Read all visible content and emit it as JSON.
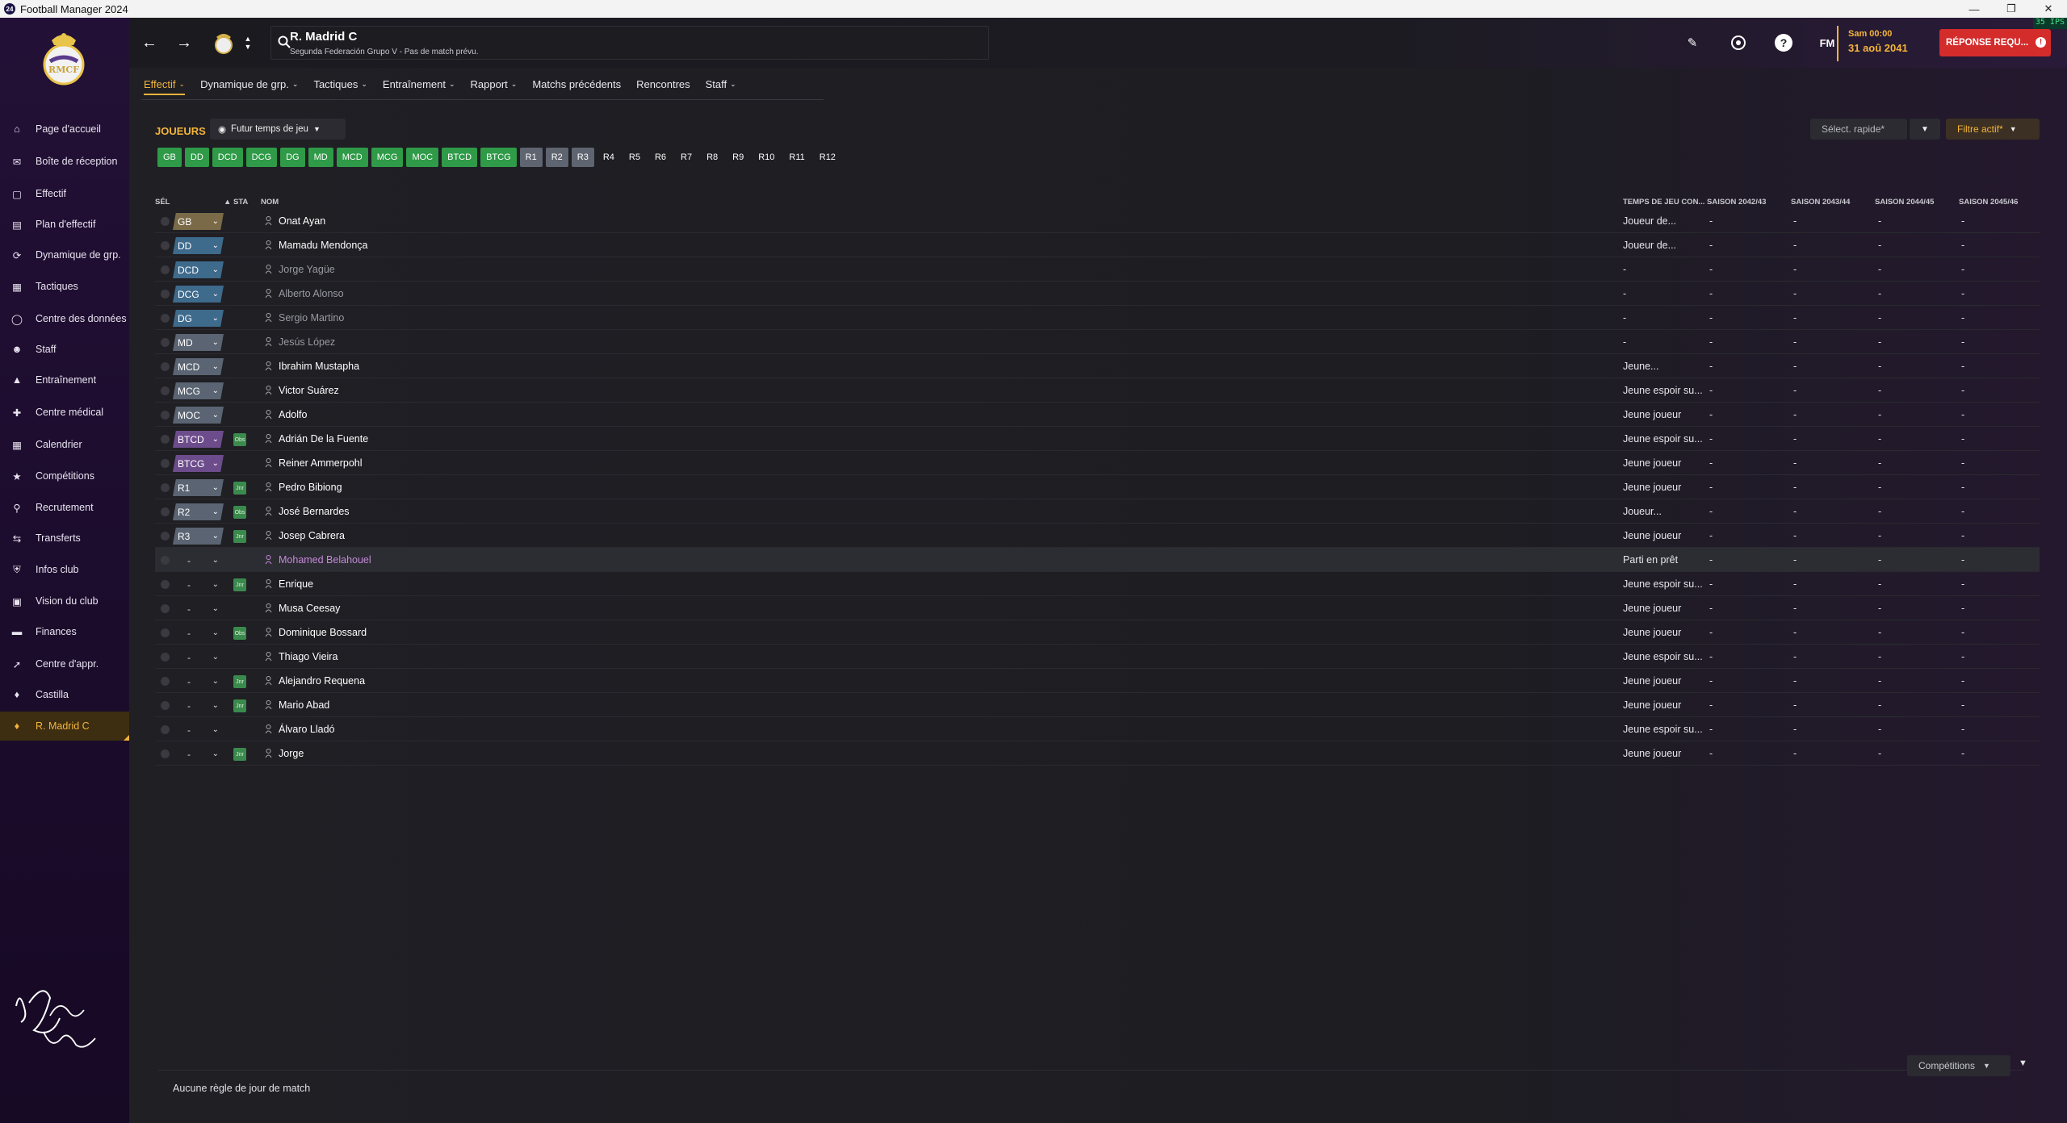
{
  "window": {
    "title": "Football Manager 2024",
    "app_icon": "24",
    "fps": "35 IPS"
  },
  "sidebar": {
    "items": [
      {
        "label": "Page d'accueil",
        "icon": "home-icon"
      },
      {
        "label": "Boîte de réception",
        "icon": "inbox-icon"
      },
      {
        "label": "Effectif",
        "icon": "shirt-icon"
      },
      {
        "label": "Plan d'effectif",
        "icon": "plan-icon"
      },
      {
        "label": "Dynamique de grp.",
        "icon": "dynamics-icon"
      },
      {
        "label": "Tactiques",
        "icon": "tactics-icon"
      },
      {
        "label": "Centre des données",
        "icon": "data-icon"
      },
      {
        "label": "Staff",
        "icon": "staff-icon"
      },
      {
        "label": "Entraînement",
        "icon": "training-icon"
      },
      {
        "label": "Centre médical",
        "icon": "medical-icon"
      },
      {
        "label": "Calendrier",
        "icon": "calendar-icon"
      },
      {
        "label": "Compétitions",
        "icon": "trophy-icon"
      },
      {
        "label": "Recrutement",
        "icon": "scouting-icon"
      },
      {
        "label": "Transferts",
        "icon": "transfers-icon"
      },
      {
        "label": "Infos club",
        "icon": "shield-icon"
      },
      {
        "label": "Vision du club",
        "icon": "vision-icon"
      },
      {
        "label": "Finances",
        "icon": "finances-icon"
      },
      {
        "label": "Centre d'appr.",
        "icon": "academy-icon"
      },
      {
        "label": "Castilla",
        "icon": "team-icon"
      },
      {
        "label": "R. Madrid C",
        "icon": "team-icon",
        "active": true
      }
    ]
  },
  "header": {
    "team_name": "R. Madrid C",
    "team_subtitle": "Segunda Federación Grupo V - Pas de match prévu.",
    "day": "Sam 00:00",
    "date": "31 aoû 2041",
    "reply_label": "RÉPONSE REQU...",
    "fm_label": "FM"
  },
  "subnav": {
    "tabs": [
      "Effectif",
      "Dynamique de grp.",
      "Tactiques",
      "Entraînement",
      "Rapport",
      "Matchs précédents",
      "Rencontres",
      "Staff"
    ]
  },
  "panel": {
    "title": "JOUEURS",
    "view": "Futur temps de jeu",
    "quick_select_placeholder": "Sélect. rapide*",
    "filter": "Filtre actif*",
    "positions_filled": [
      "GB",
      "DD",
      "DCD",
      "DCG",
      "DG",
      "MD",
      "MCD",
      "MCG",
      "MOC",
      "BTCD",
      "BTCG"
    ],
    "positions_reserve_filled": [
      "R1",
      "R2",
      "R3"
    ],
    "positions_reserve_empty": [
      "R4",
      "R5",
      "R6",
      "R7",
      "R8",
      "R9",
      "R10",
      "R11",
      "R12"
    ]
  },
  "table": {
    "headers": {
      "sel": "SÉL",
      "sta": "STA",
      "name": "NOM",
      "playtime": "TEMPS DE JEU CON...",
      "s1": "SAISON 2042/43",
      "s2": "SAISON 2043/44",
      "s3": "SAISON 2044/45",
      "s4": "SAISON 2045/46"
    },
    "rows": [
      {
        "pos": "GB",
        "sta": "",
        "name": "Onat Ayan",
        "playtime": "Joueur de...",
        "s1": "-",
        "s2": "-",
        "s3": "-",
        "s4": "-"
      },
      {
        "pos": "DD",
        "sta": "",
        "name": "Mamadu Mendonça",
        "playtime": "Joueur de...",
        "s1": "-",
        "s2": "-",
        "s3": "-",
        "s4": "-"
      },
      {
        "pos": "DCD",
        "sta": "",
        "name": "Jorge Yagüe",
        "playtime": "-",
        "s1": "-",
        "s2": "-",
        "s3": "-",
        "s4": "-",
        "dim": true
      },
      {
        "pos": "DCG",
        "sta": "",
        "name": "Alberto Alonso",
        "playtime": "-",
        "s1": "-",
        "s2": "-",
        "s3": "-",
        "s4": "-",
        "dim": true
      },
      {
        "pos": "DG",
        "sta": "",
        "name": "Sergio Martino",
        "playtime": "-",
        "s1": "-",
        "s2": "-",
        "s3": "-",
        "s4": "-",
        "dim": true
      },
      {
        "pos": "MD",
        "sta": "",
        "name": "Jesús López",
        "playtime": "-",
        "s1": "-",
        "s2": "-",
        "s3": "-",
        "s4": "-",
        "dim": true
      },
      {
        "pos": "MCD",
        "sta": "",
        "name": "Ibrahim Mustapha",
        "playtime": "Jeune...",
        "s1": "-",
        "s2": "-",
        "s3": "-",
        "s4": "-"
      },
      {
        "pos": "MCG",
        "sta": "",
        "name": "Victor Suárez",
        "playtime": "Jeune espoir su...",
        "s1": "-",
        "s2": "-",
        "s3": "-",
        "s4": "-"
      },
      {
        "pos": "MOC",
        "sta": "",
        "name": "Adolfo",
        "playtime": "Jeune joueur",
        "s1": "-",
        "s2": "-",
        "s3": "-",
        "s4": "-"
      },
      {
        "pos": "BTCD",
        "sta": "Obs",
        "name": "Adrián De la Fuente",
        "playtime": "Jeune espoir su...",
        "s1": "-",
        "s2": "-",
        "s3": "-",
        "s4": "-"
      },
      {
        "pos": "BTCG",
        "sta": "",
        "name": "Reiner Ammerpohl",
        "playtime": "Jeune joueur",
        "s1": "-",
        "s2": "-",
        "s3": "-",
        "s4": "-"
      },
      {
        "pos": "R1",
        "sta": "Jnr",
        "name": "Pedro Bibiong",
        "playtime": "Jeune joueur",
        "s1": "-",
        "s2": "-",
        "s3": "-",
        "s4": "-"
      },
      {
        "pos": "R2",
        "sta": "Obs",
        "name": "José Bernardes",
        "playtime": "Joueur...",
        "s1": "-",
        "s2": "-",
        "s3": "-",
        "s4": "-"
      },
      {
        "pos": "R3",
        "sta": "Jnr",
        "name": "Josep Cabrera",
        "playtime": "Jeune joueur",
        "s1": "-",
        "s2": "-",
        "s3": "-",
        "s4": "-"
      },
      {
        "pos": "-",
        "sta": "",
        "name": "Mohamed Belahouel",
        "playtime": "Parti en prêt",
        "s1": "-",
        "s2": "-",
        "s3": "-",
        "s4": "-",
        "loan": true
      },
      {
        "pos": "-",
        "sta": "Jnr",
        "name": "Enrique",
        "playtime": "Jeune espoir su...",
        "s1": "-",
        "s2": "-",
        "s3": "-",
        "s4": "-"
      },
      {
        "pos": "-",
        "sta": "",
        "name": "Musa Ceesay",
        "playtime": "Jeune joueur",
        "s1": "-",
        "s2": "-",
        "s3": "-",
        "s4": "-"
      },
      {
        "pos": "-",
        "sta": "Obs",
        "name": "Dominique Bossard",
        "playtime": "Jeune joueur",
        "s1": "-",
        "s2": "-",
        "s3": "-",
        "s4": "-"
      },
      {
        "pos": "-",
        "sta": "",
        "name": "Thiago Vieira",
        "playtime": "Jeune espoir su...",
        "s1": "-",
        "s2": "-",
        "s3": "-",
        "s4": "-"
      },
      {
        "pos": "-",
        "sta": "Jnr",
        "name": "Alejandro Requena",
        "playtime": "Jeune joueur",
        "s1": "-",
        "s2": "-",
        "s3": "-",
        "s4": "-"
      },
      {
        "pos": "-",
        "sta": "Jnr",
        "name": "Mario Abad",
        "playtime": "Jeune joueur",
        "s1": "-",
        "s2": "-",
        "s3": "-",
        "s4": "-"
      },
      {
        "pos": "-",
        "sta": "",
        "name": "Álvaro Lladó",
        "playtime": "Jeune espoir su...",
        "s1": "-",
        "s2": "-",
        "s3": "-",
        "s4": "-"
      },
      {
        "pos": "-",
        "sta": "Jnr",
        "name": "Jorge",
        "playtime": "Jeune joueur",
        "s1": "-",
        "s2": "-",
        "s3": "-",
        "s4": "-"
      }
    ]
  },
  "footer": {
    "rule_text": "Aucune règle de jour de match",
    "competitions": "Compétitions"
  },
  "colors": {
    "accent": "#f4b43a",
    "sidebar": "#231036",
    "filled_pos": "#2f9a47",
    "reserve_pos": "#5e6470",
    "reply": "#d42b2b",
    "gk": "#7a6a48",
    "def": "#3e6a8c",
    "mid": "#5a6472",
    "att": "#6d4c8c"
  }
}
